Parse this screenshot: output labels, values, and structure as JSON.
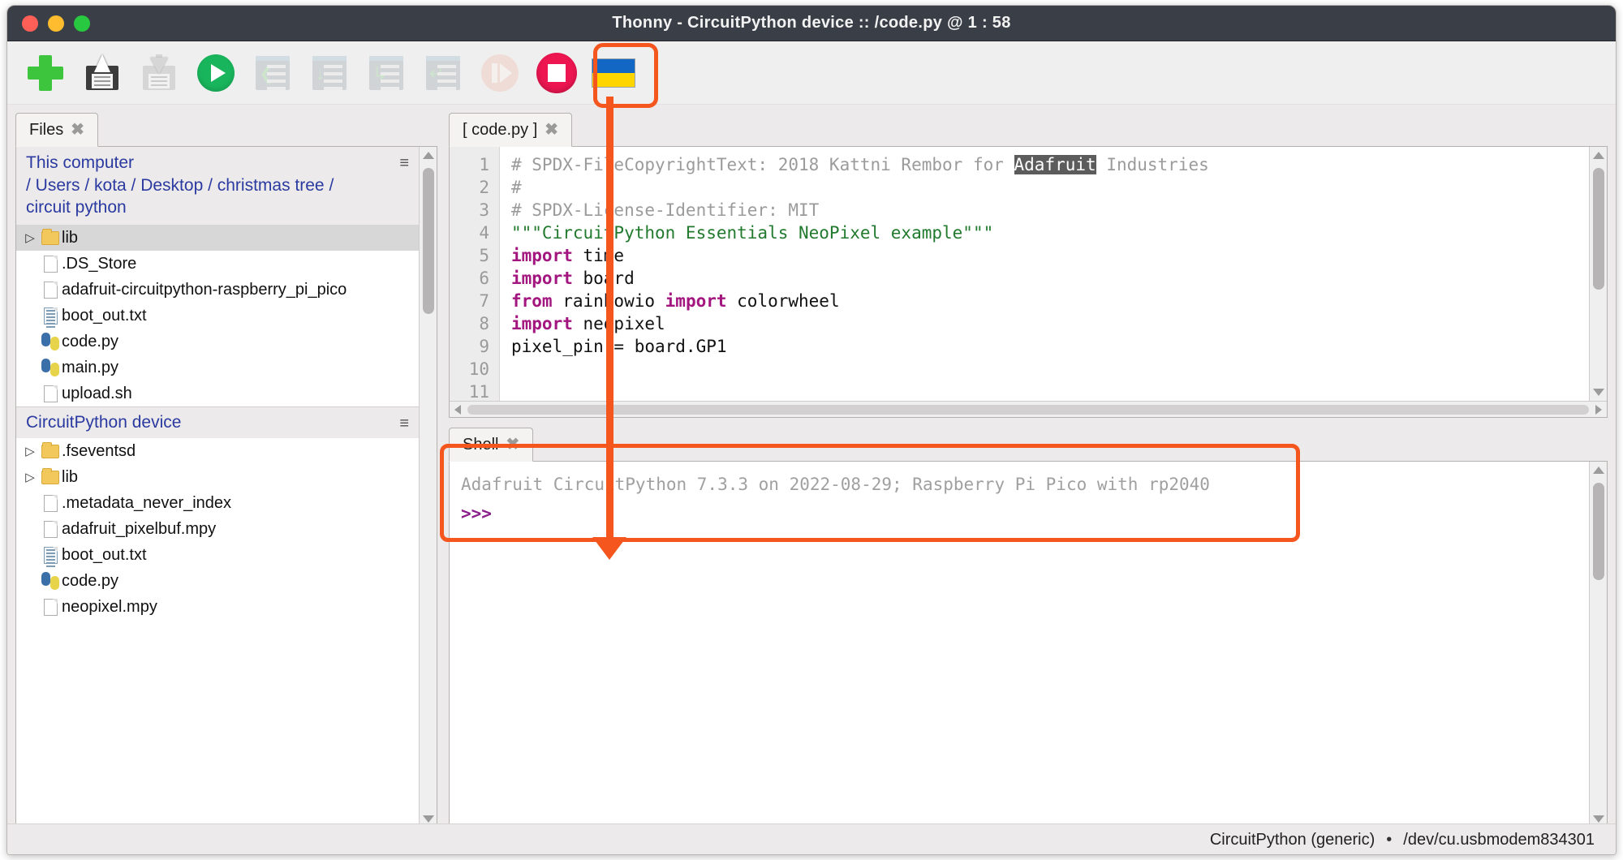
{
  "window": {
    "title": "Thonny  -  CircuitPython device :: /code.py  @  1 : 58",
    "traffic_lights": [
      "close-red",
      "minimize-yellow",
      "zoom-green"
    ]
  },
  "toolbar": {
    "buttons": [
      {
        "name": "new-file",
        "icon": "plus-icon",
        "label": "New",
        "enabled": true
      },
      {
        "name": "open-file",
        "icon": "open-folder-icon",
        "label": "Load",
        "enabled": true
      },
      {
        "name": "save-file",
        "icon": "save-disk-icon",
        "label": "Save",
        "enabled": false
      },
      {
        "name": "run-script",
        "icon": "run-play-icon",
        "label": "Run",
        "enabled": true
      },
      {
        "name": "debug-script",
        "icon": "debug-icon",
        "label": "Debug",
        "enabled": false
      },
      {
        "name": "step-over",
        "icon": "step-over-icon",
        "label": "Step over",
        "enabled": false
      },
      {
        "name": "step-into",
        "icon": "step-into-icon",
        "label": "Step into",
        "enabled": false
      },
      {
        "name": "step-out",
        "icon": "step-out-icon",
        "label": "Step out",
        "enabled": false
      },
      {
        "name": "resume",
        "icon": "resume-icon",
        "label": "Resume",
        "enabled": false
      },
      {
        "name": "stop-script",
        "icon": "stop-icon",
        "label": "Stop",
        "enabled": true,
        "highlighted": true
      },
      {
        "name": "support-ukraine",
        "icon": "ukraine-flag-icon",
        "label": "Support Ukraine",
        "enabled": true
      }
    ]
  },
  "files_panel": {
    "tab": {
      "label": "Files",
      "close": "✖"
    },
    "this_computer": {
      "title": "This computer",
      "path_line1": "/ Users / kota / Desktop / christmas tree /",
      "path_line2": "circuit python",
      "menu_icon": "≡",
      "items": [
        {
          "name": "lib",
          "type": "folder",
          "expandable": true,
          "selected": true
        },
        {
          "name": ".DS_Store",
          "type": "file",
          "expandable": false,
          "selected": false
        },
        {
          "name": "adafruit-circuitpython-raspberry_pi_pico",
          "type": "file",
          "expandable": false,
          "selected": false
        },
        {
          "name": "boot_out.txt",
          "type": "text",
          "expandable": false,
          "selected": false
        },
        {
          "name": "code.py",
          "type": "python",
          "expandable": false,
          "selected": false
        },
        {
          "name": "main.py",
          "type": "python",
          "expandable": false,
          "selected": false
        },
        {
          "name": "upload.sh",
          "type": "file",
          "expandable": false,
          "selected": false
        }
      ]
    },
    "device": {
      "title": "CircuitPython device",
      "menu_icon": "≡",
      "items": [
        {
          "name": ".fseventsd",
          "type": "folder",
          "expandable": true,
          "selected": false
        },
        {
          "name": "lib",
          "type": "folder",
          "expandable": true,
          "selected": false
        },
        {
          "name": ".metadata_never_index",
          "type": "file",
          "expandable": false,
          "selected": false
        },
        {
          "name": "adafruit_pixelbuf.mpy",
          "type": "file",
          "expandable": false,
          "selected": false
        },
        {
          "name": "boot_out.txt",
          "type": "text",
          "expandable": false,
          "selected": false
        },
        {
          "name": "code.py",
          "type": "python",
          "expandable": false,
          "selected": false
        },
        {
          "name": "neopixel.mpy",
          "type": "file",
          "expandable": false,
          "selected": false
        }
      ]
    }
  },
  "editor": {
    "tab": {
      "label": "[ code.py ]",
      "close": "✖"
    },
    "line_numbers": [
      "1",
      "2",
      "3",
      "4",
      "5",
      "6",
      "7",
      "8",
      "9",
      "10",
      "11"
    ],
    "lines": [
      {
        "n": 1,
        "segments": [
          {
            "t": "# SPDX-FileCopyrightText: 2018 Kattni Rembor for ",
            "c": "comment"
          },
          {
            "t": "Adafruit",
            "c": "selected"
          },
          {
            "t": " Industries",
            "c": "comment"
          }
        ]
      },
      {
        "n": 2,
        "segments": [
          {
            "t": "#",
            "c": "comment"
          }
        ]
      },
      {
        "n": 3,
        "segments": [
          {
            "t": "# SPDX-License-Identifier: MIT",
            "c": "comment"
          }
        ]
      },
      {
        "n": 4,
        "segments": [
          {
            "t": "",
            "c": "plain"
          }
        ]
      },
      {
        "n": 5,
        "segments": [
          {
            "t": "\"\"\"CircuitPython Essentials NeoPixel example\"\"\"",
            "c": "string"
          }
        ]
      },
      {
        "n": 6,
        "segments": [
          {
            "t": "import",
            "c": "kw"
          },
          {
            "t": " time",
            "c": "plain"
          }
        ]
      },
      {
        "n": 7,
        "segments": [
          {
            "t": "import",
            "c": "kw"
          },
          {
            "t": " board",
            "c": "plain"
          }
        ]
      },
      {
        "n": 8,
        "segments": [
          {
            "t": "from",
            "c": "kw"
          },
          {
            "t": " rainbowio ",
            "c": "plain"
          },
          {
            "t": "import",
            "c": "kw"
          },
          {
            "t": " colorwheel",
            "c": "plain"
          }
        ]
      },
      {
        "n": 9,
        "segments": [
          {
            "t": "import",
            "c": "kw"
          },
          {
            "t": " neopixel",
            "c": "plain"
          }
        ]
      },
      {
        "n": 10,
        "segments": [
          {
            "t": "",
            "c": "plain"
          }
        ]
      },
      {
        "n": 11,
        "segments": [
          {
            "t": "pixel_pin = board.GP1",
            "c": "plain"
          }
        ]
      }
    ]
  },
  "shell": {
    "tab": {
      "label": "Shell",
      "close": "✖"
    },
    "banner": "Adafruit CircuitPython 7.3.3 on 2022-08-29; Raspberry Pi Pico with rp2040",
    "prompt": ">>>",
    "highlighted": true
  },
  "statusbar": {
    "interpreter": "CircuitPython (generic)",
    "separator": "•",
    "port": "/dev/cu.usbmodem834301"
  },
  "colors": {
    "accent_orange": "#f4561d",
    "titlebar": "#3a3f47",
    "link_blue": "#2b3aa0",
    "keyword_purple": "#a3157f",
    "string_green": "#227a2e",
    "comment_gray": "#9b9b9b",
    "stop_red": "#ed1651",
    "run_green": "#19b55c"
  }
}
